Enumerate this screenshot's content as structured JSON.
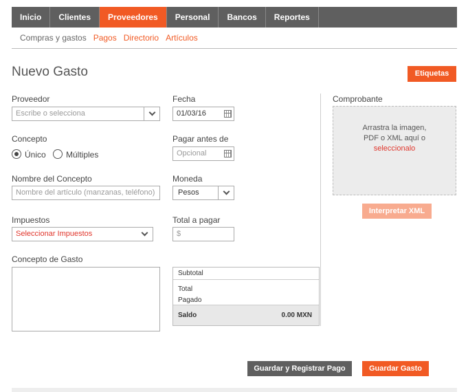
{
  "topnav": {
    "tabs": [
      {
        "label": "Inicio"
      },
      {
        "label": "Clientes"
      },
      {
        "label": "Proveedores"
      },
      {
        "label": "Personal"
      },
      {
        "label": "Bancos"
      },
      {
        "label": "Reportes"
      }
    ],
    "active": "Proveedores"
  },
  "subnav": {
    "items": [
      {
        "label": "Compras y gastos"
      },
      {
        "label": "Pagos"
      },
      {
        "label": "Directorio"
      },
      {
        "label": "Artículos"
      }
    ]
  },
  "page": {
    "title": "Nuevo Gasto",
    "tags_button": "Etiquetas"
  },
  "form": {
    "proveedor": {
      "label": "Proveedor",
      "placeholder": "Escribe o selecciona"
    },
    "fecha": {
      "label": "Fecha",
      "value": "01/03/16"
    },
    "concepto": {
      "label": "Concepto",
      "option_unico": "Único",
      "option_multiples": "Múltiples",
      "selected": "Único"
    },
    "pagar_antes": {
      "label": "Pagar antes de",
      "placeholder": "Opcional"
    },
    "nombre_concepto": {
      "label": "Nombre del Concepto",
      "placeholder": "Nombre del artículo (manzanas,  teléfono)"
    },
    "moneda": {
      "label": "Moneda",
      "value": "Pesos"
    },
    "impuestos": {
      "label": "Impuestos",
      "value": "Seleccionar Impuestos"
    },
    "total": {
      "label": "Total a pagar",
      "placeholder": "$"
    },
    "concepto_gasto": {
      "label": "Concepto de Gasto"
    }
  },
  "totals": {
    "subtotal": "Subtotal",
    "total": "Total",
    "pagado": "Pagado",
    "saldo_label": "Saldo",
    "saldo_value": "0.00 MXN"
  },
  "comprobante": {
    "label": "Comprobante",
    "line1": "Arrastra la imagen,",
    "line2": "PDF o XML aquí o",
    "link": "seleccionalo",
    "xml_button": "Interpretar XML"
  },
  "actions": {
    "save_and_pay": "Guardar y Registrar Pago",
    "save": "Guardar Gasto"
  },
  "colors": {
    "accent": "#f15a24",
    "nav": "#5f5f5f",
    "link": "#e0352b"
  }
}
